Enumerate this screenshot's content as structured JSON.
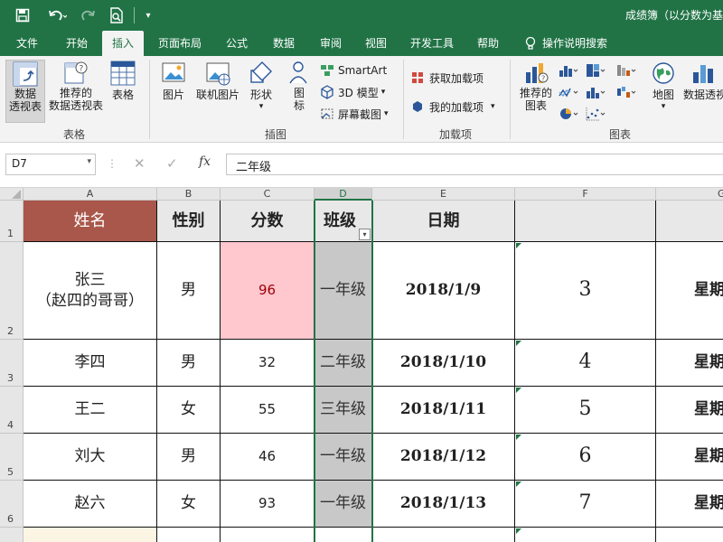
{
  "title_bar": {
    "title": "成绩簿（以分数为基",
    "save_icon": "save-icon",
    "undo_icon": "undo-icon",
    "redo_icon": "redo-icon",
    "preview_icon": "print-preview-icon",
    "customize_icon": "customize-qat-icon"
  },
  "tabs": [
    "文件",
    "开始",
    "插入",
    "页面布局",
    "公式",
    "数据",
    "审阅",
    "视图",
    "开发工具",
    "帮助",
    "操作说明搜索"
  ],
  "active_tab": "插入",
  "ribbon": {
    "tables": {
      "label": "表格",
      "pivot": "数据\n透视表",
      "recommended_pivot": "推荐的\n数据透视表",
      "table": "表格"
    },
    "illustrations": {
      "label": "插图",
      "pictures": "图片",
      "online_pictures": "联机图片",
      "shapes": "形状",
      "icons": "图\n标",
      "smartart": "SmartArt",
      "model3d": "3D 模型",
      "screenshot": "屏幕截图"
    },
    "addins": {
      "label": "加载项",
      "get": "获取加载项",
      "my": "我的加载项"
    },
    "charts": {
      "label": "图表",
      "recommended": "推荐的\n图表",
      "maps": "地图",
      "pivot_chart": "数据透视"
    }
  },
  "formula_bar": {
    "name_box": "D7",
    "content": "二年级"
  },
  "columns": [
    "A",
    "B",
    "C",
    "D",
    "E",
    "F",
    "G"
  ],
  "selected_column": "D",
  "rows": [
    "1",
    "2",
    "3",
    "4",
    "5",
    "6"
  ],
  "header": [
    "姓名",
    "性别",
    "分数",
    "班级",
    "日期",
    "",
    ""
  ],
  "data": [
    {
      "name": "张三\n（赵四的哥哥）",
      "gender": "男",
      "score": "96",
      "class": "一年级",
      "date": "2018/1/9",
      "num": "3",
      "week": "星期"
    },
    {
      "name": "李四",
      "gender": "男",
      "score": "32",
      "class": "二年级",
      "date": "2018/1/10",
      "num": "4",
      "week": "星期"
    },
    {
      "name": "王二",
      "gender": "女",
      "score": "55",
      "class": "三年级",
      "date": "2018/1/11",
      "num": "5",
      "week": "星期"
    },
    {
      "name": "刘大",
      "gender": "男",
      "score": "46",
      "class": "一年级",
      "date": "2018/1/12",
      "num": "6",
      "week": "星期"
    },
    {
      "name": "赵六",
      "gender": "女",
      "score": "93",
      "class": "一年级",
      "date": "2018/1/13",
      "num": "7",
      "week": "星期"
    }
  ],
  "colors": {
    "excel_green": "#217346",
    "name_header": "#a9574a",
    "highlight_score": "#ffc7ce",
    "class_column": "#c8c8c8"
  }
}
